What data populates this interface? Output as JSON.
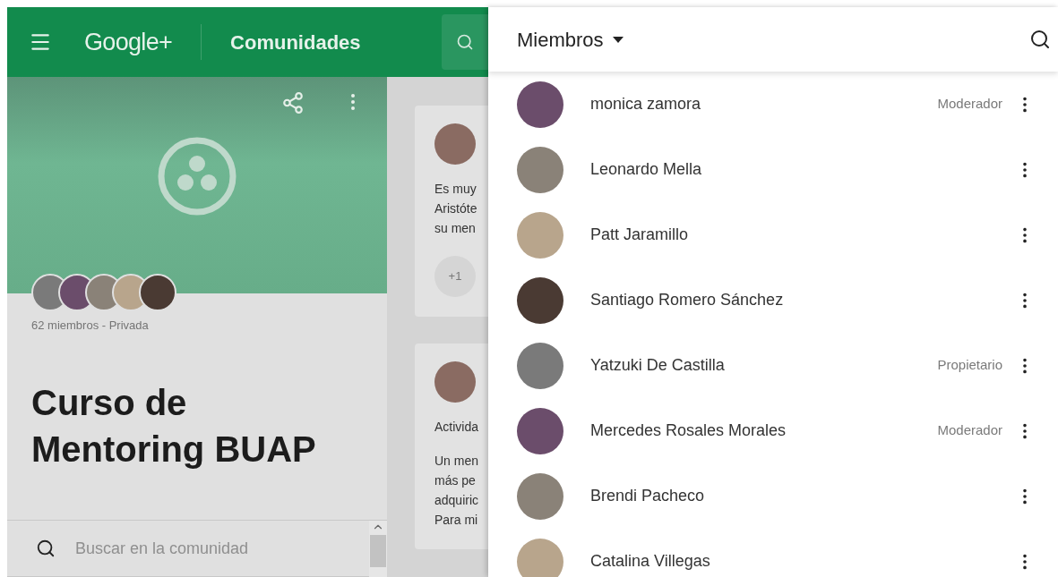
{
  "header": {
    "logo": "Google+",
    "section": "Comunidades"
  },
  "community": {
    "meta": "62 miembros - Privada",
    "title": "Curso de Mentoring BUAP",
    "search": {
      "placeholder": "Buscar en la comunidad"
    }
  },
  "feed": {
    "posts": [
      {
        "paragraphs": [
          [
            "Es muy",
            "Aristóte",
            "su men"
          ]
        ],
        "plus_one": "+1"
      },
      {
        "paragraphs": [
          [
            "Activida"
          ],
          [
            "Un men",
            "más pe",
            "adquiric",
            "Para mi"
          ]
        ]
      }
    ]
  },
  "members_panel": {
    "title": "Miembros",
    "members": [
      {
        "name": "monica zamora",
        "role": "Moderador"
      },
      {
        "name": "Leonardo Mella"
      },
      {
        "name": "Patt Jaramillo"
      },
      {
        "name": "Santiago Romero Sánchez"
      },
      {
        "name": "Yatzuki De Castilla",
        "role": "Propietario"
      },
      {
        "name": "Mercedes Rosales Morales",
        "role": "Moderador"
      },
      {
        "name": "Brendi Pacheco"
      },
      {
        "name": "Catalina Villegas"
      }
    ]
  }
}
